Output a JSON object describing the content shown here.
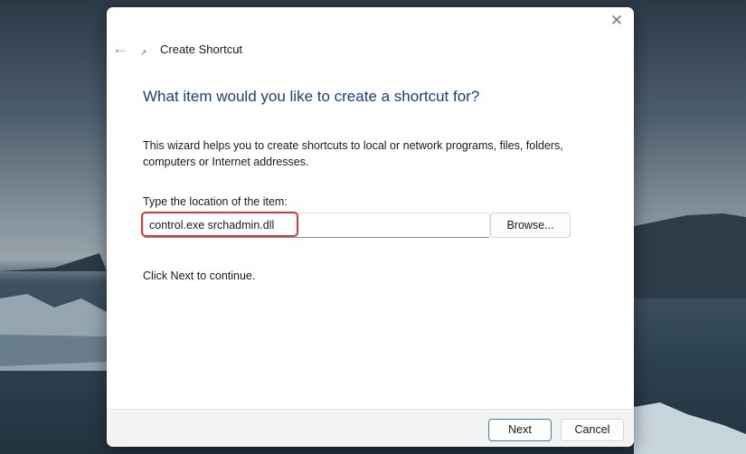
{
  "window": {
    "title": "Create Shortcut",
    "back_icon": "arrow-left-icon",
    "app_icon": "shortcut-icon",
    "close_icon": "close-icon"
  },
  "main": {
    "heading": "What item would you like to create a shortcut for?",
    "description": "This wizard helps you to create shortcuts to local or network programs, files, folders, computers or Internet addresses.",
    "location_label": "Type the location of the item:",
    "location_value": "control.exe srchadmin.dll",
    "browse_label": "Browse...",
    "continue_text": "Click Next to continue.",
    "highlight_color": "#d0393e"
  },
  "footer": {
    "next_label": "Next",
    "cancel_label": "Cancel"
  }
}
